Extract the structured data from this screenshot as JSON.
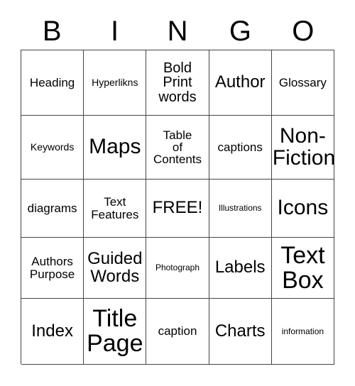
{
  "card": {
    "header_letters": [
      "B",
      "I",
      "N",
      "G",
      "O"
    ],
    "columns": 5,
    "rows": 5,
    "grid_line_color": "#444444",
    "background_color": "#ffffff",
    "text_color": "#000000",
    "cells": [
      {
        "text": "Heading",
        "size": "md"
      },
      {
        "text": "Hyperlikns",
        "size": "sm"
      },
      {
        "text": "Bold\nPrint\nwords",
        "size": "lg"
      },
      {
        "text": "Author",
        "size": "xl"
      },
      {
        "text": "Glossary",
        "size": "md"
      },
      {
        "text": "Keywords",
        "size": "sm"
      },
      {
        "text": "Maps",
        "size": "xxl"
      },
      {
        "text": "Table\nof\nContents",
        "size": "md"
      },
      {
        "text": "captions",
        "size": "md"
      },
      {
        "text": "Non-\nFiction",
        "size": "xxl"
      },
      {
        "text": "diagrams",
        "size": "md"
      },
      {
        "text": "Text\nFeatures",
        "size": "md"
      },
      {
        "text": "FREE!",
        "size": "xl"
      },
      {
        "text": "Illustrations",
        "size": "xs"
      },
      {
        "text": "Icons",
        "size": "xxl"
      },
      {
        "text": "Authors\nPurpose",
        "size": "md"
      },
      {
        "text": "Guided\nWords",
        "size": "xl"
      },
      {
        "text": "Photograph",
        "size": "xs"
      },
      {
        "text": "Labels",
        "size": "xl"
      },
      {
        "text": "Text\nBox",
        "size": "huge"
      },
      {
        "text": "Index",
        "size": "xl"
      },
      {
        "text": "Title\nPage",
        "size": "huge"
      },
      {
        "text": "caption",
        "size": "md"
      },
      {
        "text": "Charts",
        "size": "xl"
      },
      {
        "text": "information",
        "size": "xs"
      }
    ]
  }
}
